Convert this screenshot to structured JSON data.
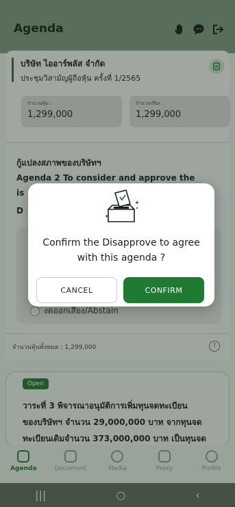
{
  "header": {
    "title": "Agenda"
  },
  "company": {
    "name": "บริษัท ไออาร์พลัส จำกัด",
    "meeting": "ประชุมวิสามัญผู้ถือหุ้น ครั้งที่ 1/2565",
    "shares_label": "จำนวนหุ้น :",
    "shares_value": "1,299,000",
    "votes_label": "จำนวนเสียง :",
    "votes_value": "1,299,000"
  },
  "agenda": {
    "thai_line": "กู้แปลงสภาพของบริษัทฯ",
    "en_line1": "Agenda 2 To consider and approve the",
    "en_line2": "is",
    "en_line3": "D",
    "abstain_label": "งดออกเสียง/Abstain",
    "total_shares": "จำนวนหุ้นทั้งหมด : 1,299,000"
  },
  "open_card": {
    "badge": "Open",
    "line1": "วาระที่ 3 พิจารณาอนุมัติการเพิ่มทุนจดทะเบียน",
    "line2": "ของบริษัทฯ จำนวน 29,000,000 บาท จากทุนจด",
    "line3": "ทะเบียนเดิมจำนวน 373,000,000 บาท เป็นทุนจด"
  },
  "nav": [
    {
      "label": "Agenda",
      "active": true
    },
    {
      "label": "Document",
      "active": false
    },
    {
      "label": "Media",
      "active": false
    },
    {
      "label": "Proxy",
      "active": false
    },
    {
      "label": "Profile",
      "active": false
    }
  ],
  "modal": {
    "message_line1": "Confirm the  Disapprove to agree",
    "message_line2": "with this agenda ?",
    "cancel_label": "CANCEL",
    "confirm_label": "CONFIRM"
  },
  "colors": {
    "accent": "#1f7a32",
    "header": "#7d9a80"
  }
}
